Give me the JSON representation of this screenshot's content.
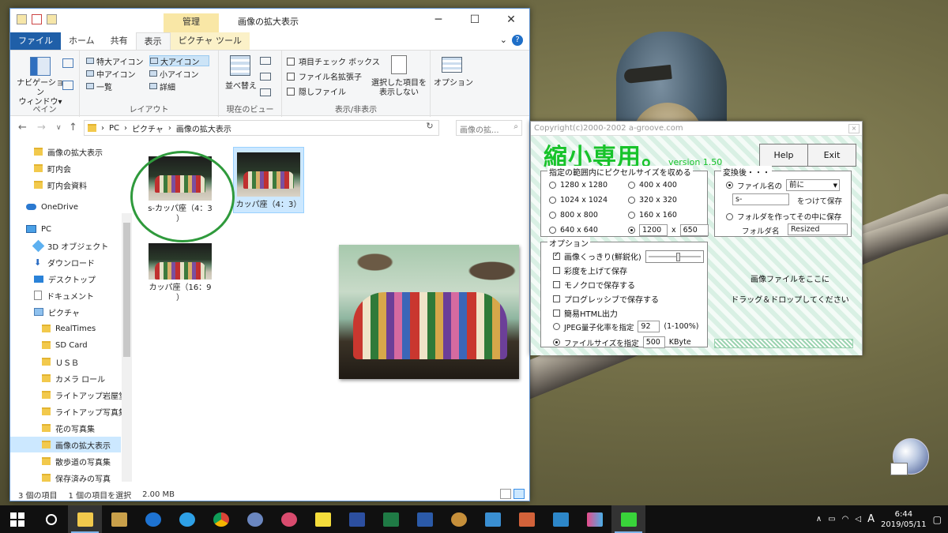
{
  "explorer": {
    "window_title": "画像の拡大表示",
    "manage_tab": "管理",
    "tabs": [
      "ファイル",
      "ホーム",
      "共有",
      "表示",
      "ピクチャ ツール"
    ],
    "ribbon": {
      "pane_group": {
        "label": "ペイン",
        "nav_pane": "ナビゲーション\nウィンドウ▾"
      },
      "layout_group": {
        "label": "レイアウト",
        "items": [
          "特大アイコン",
          "大アイコン",
          "中アイコン",
          "小アイコン",
          "一覧",
          "詳細"
        ]
      },
      "view_group": {
        "label": "現在のビュー",
        "sort": "並べ替え"
      },
      "show_hide_group": {
        "label": "表示/非表示",
        "checkboxes": [
          "項目チェック ボックス",
          "ファイル名拡張子",
          "隠しファイル"
        ],
        "hide_selected": "選択した項目を\n表示しない"
      },
      "options": "オプション"
    },
    "address": {
      "path": [
        "PC",
        "ピクチャ",
        "画像の拡大表示"
      ],
      "search_placeholder": "画像の拡..."
    },
    "nav_items": [
      {
        "label": "画像の拡大表示",
        "icon": "folder-icon"
      },
      {
        "label": "町内会",
        "icon": "folder-icon"
      },
      {
        "label": "町内会資料",
        "icon": "folder-icon"
      },
      {
        "label": "OneDrive",
        "icon": "cloud-icon"
      },
      {
        "label": "PC",
        "icon": "pc-icon"
      },
      {
        "label": "3D オブジェクト",
        "icon": "3d-objects-icon"
      },
      {
        "label": "ダウンロード",
        "icon": "download-icon"
      },
      {
        "label": "デスクトップ",
        "icon": "desktop-icon"
      },
      {
        "label": "ドキュメント",
        "icon": "document-icon"
      },
      {
        "label": "ピクチャ",
        "icon": "pictures-icon"
      },
      {
        "label": "RealTimes",
        "icon": "folder-icon"
      },
      {
        "label": "SD Card",
        "icon": "folder-icon"
      },
      {
        "label": "ＵＳＢ",
        "icon": "folder-icon"
      },
      {
        "label": "カメラ ロール",
        "icon": "folder-icon"
      },
      {
        "label": "ライトアップ岩屋堂",
        "icon": "folder-icon"
      },
      {
        "label": "ライトアップ写真集",
        "icon": "folder-icon"
      },
      {
        "label": "花の写真集",
        "icon": "folder-icon"
      },
      {
        "label": "画像の拡大表示",
        "icon": "folder-icon",
        "selected": true
      },
      {
        "label": "散歩道の写真集",
        "icon": "folder-icon"
      },
      {
        "label": "保存済みの写真",
        "icon": "folder-icon"
      }
    ],
    "files": [
      {
        "name": "s-カッパ座（4：3\n）"
      },
      {
        "name": "カッパ座（4：3）"
      },
      {
        "name": "カッパ座（16：9\n）"
      }
    ],
    "status": {
      "count": "3 個の項目",
      "selected": "1 個の項目を選択",
      "size": "2.00 MB"
    }
  },
  "resizer": {
    "copyright": "Copyright(c)2000-2002 a-groove.com",
    "logo": "縮小専用。",
    "version": "version 1.50",
    "help_label": "Help",
    "exit_label": "Exit",
    "size_group": {
      "title": "指定の範囲内にピクセルサイズを収める",
      "options": [
        "1280 x 1280",
        "400 x 400",
        "1024 x 1024",
        "320 x 320",
        "800 x 800",
        "160 x 160",
        "640 x 640"
      ],
      "custom_w": "1200",
      "custom_x": "x",
      "custom_h": "650"
    },
    "after_group": {
      "title": "変換後・・・",
      "filename_label": "ファイル名の",
      "position_value": "前に",
      "prefix_value": "s-",
      "suffix_label": "をつけて保存",
      "folder_label": "フォルダを作ってその中に保存",
      "folder_name_label": "フォルダ名",
      "folder_name_value": "Resized"
    },
    "options_group": {
      "title": "オプション",
      "items": [
        "画像くっきり(鮮鋭化)",
        "彩度を上げて保存",
        "モノクロで保存する",
        "プログレッシブで保存する",
        "簡易HTML出力"
      ],
      "jpeg_label": "JPEG量子化率を指定",
      "jpeg_value": "92",
      "jpeg_unit": "(1-100%)",
      "filesize_label": "ファイルサイズを指定",
      "filesize_value": "500",
      "filesize_unit": "KByte"
    },
    "drop_text": "画像ファイルをここに\nドラッグ＆ドロップしてください"
  },
  "taskbar": {
    "time": "6:44",
    "date": "2019/05/11",
    "ime": "A"
  }
}
